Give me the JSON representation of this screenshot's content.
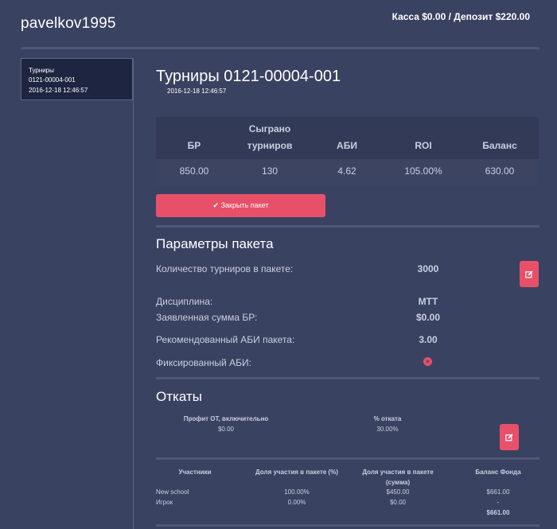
{
  "header": {
    "username": "pavelkov1995",
    "balance": "Касса $0.00 / Депозит $220.00"
  },
  "sidebar": {
    "card_line1": "Турниры",
    "card_line2": "0121-00004-001",
    "card_line3": "2016-12-18 12:46:57"
  },
  "main": {
    "title": "Турниры 0121-00004-001",
    "date": "2016-12-18 12:46:57",
    "stats": {
      "headers": [
        "БР",
        "Сыграно турниров",
        "АБИ",
        "ROI",
        "Баланс"
      ],
      "values": [
        "850.00",
        "130",
        "4.62",
        "105.00%",
        "630.00"
      ]
    },
    "close_button": "Закрыть пакет",
    "params": {
      "title": "Параметры пакета",
      "count_label": "Количество турниров в пакете:",
      "count_value": "3000",
      "discipline_label": "Дисциплина:",
      "discipline_value": "MTT",
      "br_label": "Заявленная сумма БР:",
      "br_value": "$0.00",
      "abi_label": "Рекомендованный АБИ пакета:",
      "abi_value": "3.00",
      "fixed_label": "Фиксированный АБИ:",
      "fixed_value": false
    },
    "rollbacks": {
      "title": "Откаты",
      "col1_header": "Профит ОТ, включительно",
      "col2_header": "% отката",
      "row1": [
        "$0.00",
        "30.00%"
      ]
    },
    "participants": {
      "header_name": "Участники",
      "header_pct": "Доля участия в пакете (%)",
      "header_sum": "Доля участия в пакете (сумма)",
      "header_fund": "Баланс Фонда",
      "rows": [
        {
          "name": "New school",
          "pct": "100.00%",
          "sum": "$450.00",
          "fund": "$661.00"
        },
        {
          "name": "Игрок",
          "pct": "0.00%",
          "sum": "$0.00",
          "fund": "-"
        }
      ],
      "fund_total": "$661.00"
    }
  },
  "colors": {
    "background": "#3a4261",
    "accent": "#e8506a"
  }
}
